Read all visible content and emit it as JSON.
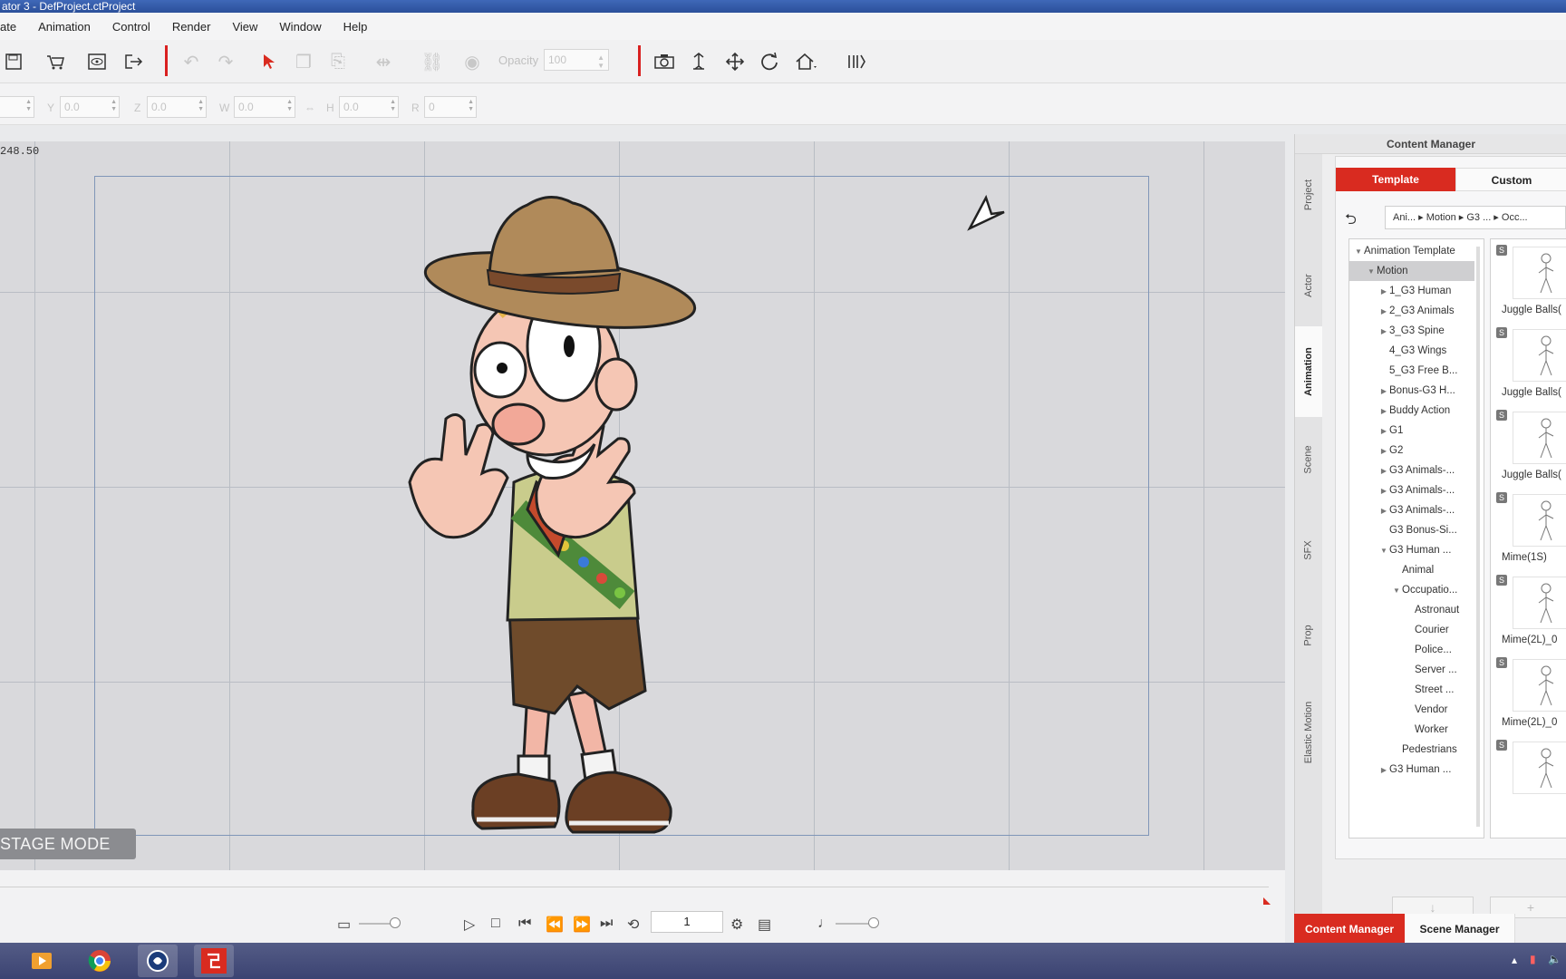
{
  "window": {
    "title": "ator 3  - DefProject.ctProject"
  },
  "menu": [
    "ate",
    "Animation",
    "Control",
    "Render",
    "View",
    "Window",
    "Help"
  ],
  "toolbar": {
    "opacity_label": "Opacity",
    "opacity_value": "100"
  },
  "transform": {
    "x_value": "",
    "y_label": "Y",
    "y_value": "0.0",
    "z_label": "Z",
    "z_value": "0.0",
    "w_label": "W",
    "w_value": "0.0",
    "h_label": "H",
    "h_value": "0.0",
    "r_label": "R",
    "r_value": "0"
  },
  "stage": {
    "coord_readout": "248.50",
    "mode_label": "STAGE MODE"
  },
  "timeline": {
    "current_frame": "1"
  },
  "content_manager": {
    "title": "Content Manager",
    "side_tabs": [
      "Project",
      "Actor",
      "Animation",
      "Scene",
      "SFX",
      "Prop",
      "Elastic Motion"
    ],
    "active_side_tab": "Animation",
    "tabs": {
      "template": "Template",
      "custom": "Custom"
    },
    "breadcrumb": "Ani...  ▸ Motion ▸  G3 ...  ▸  Occ...",
    "tree": [
      {
        "label": "Animation Template",
        "indent": 0,
        "arrow": "▼"
      },
      {
        "label": "Motion",
        "indent": 1,
        "arrow": "▼",
        "selected": true
      },
      {
        "label": "1_G3 Human",
        "indent": 2,
        "arrow": "▶"
      },
      {
        "label": "2_G3 Animals",
        "indent": 2,
        "arrow": "▶"
      },
      {
        "label": "3_G3 Spine",
        "indent": 2,
        "arrow": "▶"
      },
      {
        "label": "4_G3 Wings",
        "indent": 2,
        "arrow": ""
      },
      {
        "label": "5_G3 Free B...",
        "indent": 2,
        "arrow": ""
      },
      {
        "label": "Bonus-G3 H...",
        "indent": 2,
        "arrow": "▶"
      },
      {
        "label": "Buddy Action",
        "indent": 2,
        "arrow": "▶"
      },
      {
        "label": "G1",
        "indent": 2,
        "arrow": "▶"
      },
      {
        "label": "G2",
        "indent": 2,
        "arrow": "▶"
      },
      {
        "label": "G3 Animals-...",
        "indent": 2,
        "arrow": "▶"
      },
      {
        "label": "G3 Animals-...",
        "indent": 2,
        "arrow": "▶"
      },
      {
        "label": "G3 Animals-...",
        "indent": 2,
        "arrow": "▶"
      },
      {
        "label": "G3 Bonus-Si...",
        "indent": 2,
        "arrow": ""
      },
      {
        "label": "G3 Human ...",
        "indent": 2,
        "arrow": "▼"
      },
      {
        "label": "Animal",
        "indent": 3,
        "arrow": ""
      },
      {
        "label": "Occupatio...",
        "indent": 3,
        "arrow": "▼"
      },
      {
        "label": "Astronaut",
        "indent": 4,
        "arrow": ""
      },
      {
        "label": "Courier",
        "indent": 4,
        "arrow": ""
      },
      {
        "label": "Police...",
        "indent": 4,
        "arrow": ""
      },
      {
        "label": "Server ...",
        "indent": 4,
        "arrow": ""
      },
      {
        "label": "Street ...",
        "indent": 4,
        "arrow": ""
      },
      {
        "label": "Vendor",
        "indent": 4,
        "arrow": ""
      },
      {
        "label": "Worker",
        "indent": 4,
        "arrow": ""
      },
      {
        "label": "Pedestrians",
        "indent": 3,
        "arrow": ""
      },
      {
        "label": "G3 Human ...",
        "indent": 2,
        "arrow": "▶"
      }
    ],
    "thumbnails": [
      "Juggle Balls(",
      "Juggle Balls(",
      "Juggle Balls(",
      "Mime(1S)",
      "Mime(2L)_0",
      "Mime(2L)_0",
      ""
    ],
    "thumbnail_badge": "S"
  },
  "bottom_tabs": {
    "content_manager": "Content Manager",
    "scene_manager": "Scene Manager"
  }
}
